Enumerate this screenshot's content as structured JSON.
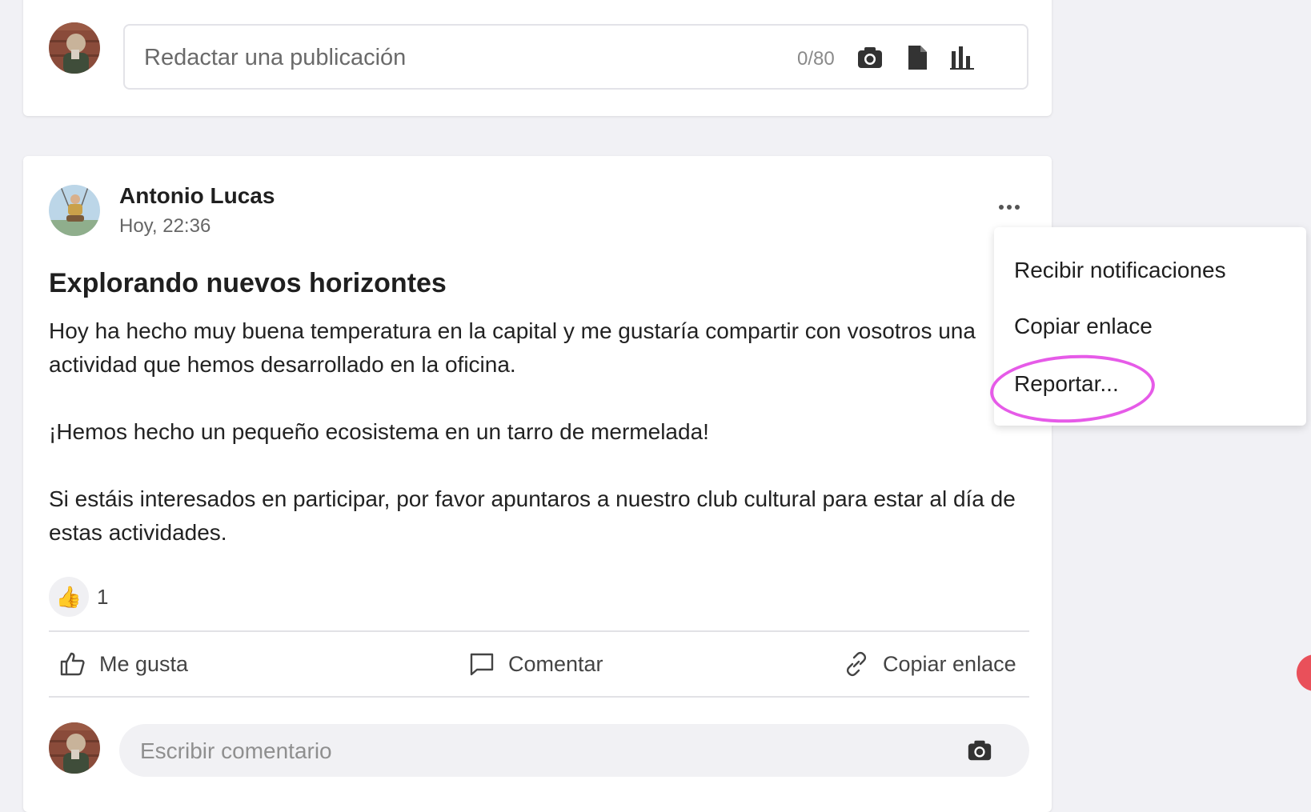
{
  "composer": {
    "placeholder": "Redactar una publicación",
    "counter": "0/80",
    "icons": [
      "camera-icon",
      "document-icon",
      "bar-chart-icon"
    ]
  },
  "post": {
    "author": "Antonio Lucas",
    "time": "Hoy, 22:36",
    "title": "Explorando nuevos horizontes",
    "paragraphs": [
      "Hoy ha hecho muy buena temperatura en la capital y me gustaría compartir con vosotros una actividad que hemos desarrollado en la oficina.",
      "¡Hemos hecho un pequeño ecosistema en un tarro de mermelada!",
      "Si estáis interesados en participar, por favor apuntaros a nuestro club cultural para estar al día de estas actividades."
    ],
    "reaction_emoji": "👍",
    "reaction_count": "1",
    "actions": {
      "like": "Me gusta",
      "comment": "Comentar",
      "copy_link": "Copiar enlace"
    },
    "comment_placeholder": "Escribir comentario"
  },
  "menu": {
    "items": [
      "Recibir notificaciones",
      "Copiar enlace",
      "Reportar..."
    ]
  },
  "colors": {
    "background": "#f1f1f5",
    "highlight": "#e65be8",
    "edge_button": "#e9505a"
  }
}
